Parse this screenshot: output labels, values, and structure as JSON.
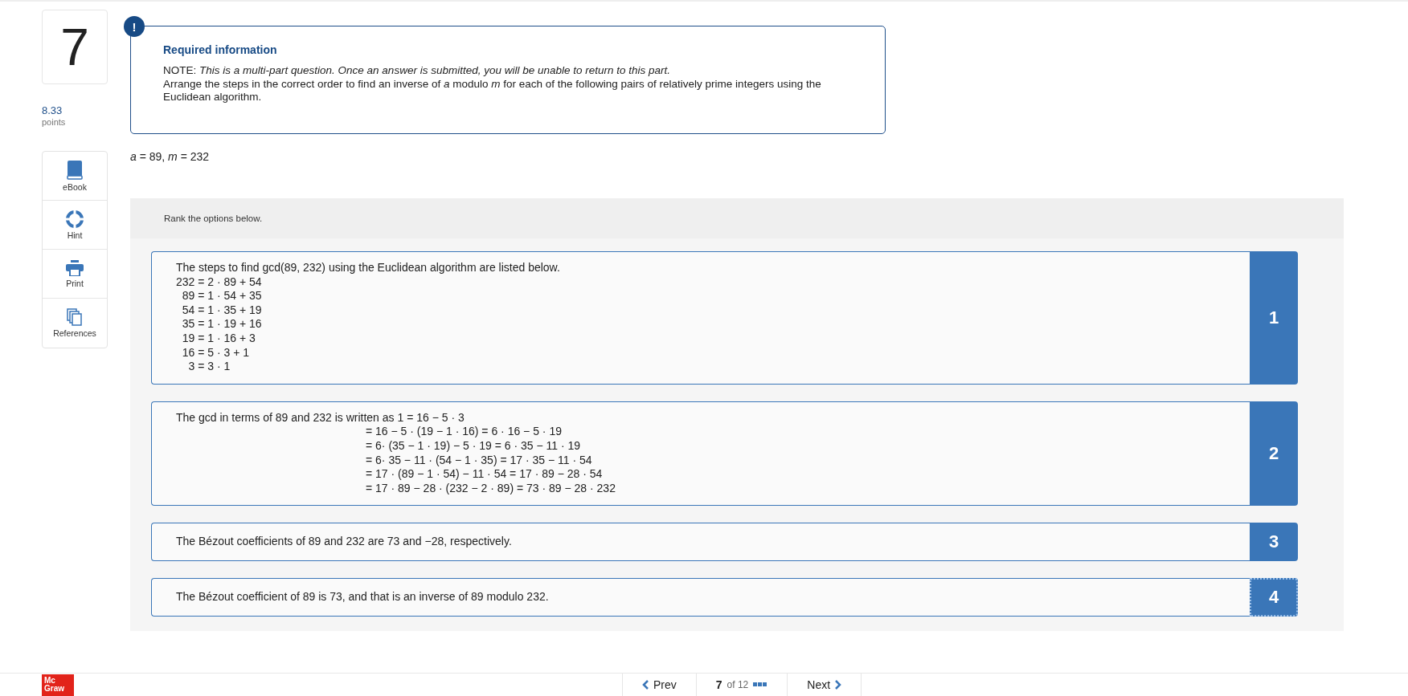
{
  "question": {
    "number": "7",
    "points": "8.33",
    "points_label": "points"
  },
  "tools": [
    {
      "kind": "book",
      "label": "eBook"
    },
    {
      "kind": "lifebuoy",
      "label": "Hint"
    },
    {
      "kind": "printer",
      "label": "Print"
    },
    {
      "kind": "pages",
      "label": "References"
    }
  ],
  "note": {
    "icon": "!",
    "title": "Required information",
    "text": "NOTE: *This is a multi-part question. Once an answer is submitted, you will be unable to return to this part.*",
    "instructions": "Arrange the steps in the correct order to find an inverse of *a* modulo *m* for each of the following pairs of relatively prime integers using the Euclidean algorithm."
  },
  "given": "*a* = 89, *m* = 232",
  "ranking": {
    "prompt": "Rank the options below.",
    "items": [
      {
        "kind": "steps",
        "rank": "1",
        "focused": false,
        "text": "The steps to find gcd(89, 232) using the Euclidean algorithm are listed below.",
        "lines": [
          "232 = 2 · 89 + 54",
          "  89 = 1 · 54 + 35",
          "  54 = 1 · 35 + 19",
          "  35 = 1 · 19 + 16",
          "  19 = 1 · 16 + 3",
          "  16 = 5 · 3 + 1",
          "    3 = 3 · 1"
        ]
      },
      {
        "kind": "derivation",
        "rank": "2",
        "focused": false,
        "text": "The gcd in terms of 89 and 232 is written as 1 = 16 − 5 · 3",
        "lines": [
          "= 16 − 5 · (19 − 1 · 16) = 6 · 16 − 5 · 19",
          "= 6· (35 − 1 · 19) − 5 · 19 = 6 · 35 − 11 · 19",
          "= 6· 35 − 11 · (54 − 1 · 35) = 17 · 35 − 11 · 54",
          "= 17 · (89 − 1 · 54) − 11 · 54 = 17 · 89 − 28 · 54",
          "= 17 · 89 − 28 · (232 − 2 · 89) = 73 · 89 − 28 · 232"
        ]
      },
      {
        "kind": "sentence",
        "rank": "3",
        "focused": false,
        "text": "The Bézout coefficients of 89 and 232 are 73 and −28, respectively."
      },
      {
        "kind": "sentence",
        "rank": "4",
        "focused": true,
        "text": "The Bézout coefficient of 89 is 73, and that is an inverse of 89 modulo 232."
      }
    ]
  },
  "footer": {
    "logo": [
      "Mc",
      "Graw"
    ],
    "prev": "Prev",
    "current": "7",
    "total": "of 12",
    "next": "Next"
  }
}
